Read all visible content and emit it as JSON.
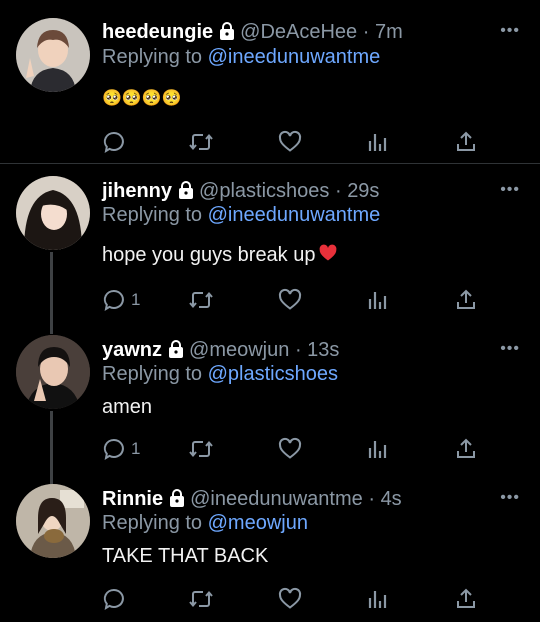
{
  "tweets": [
    {
      "name": "heedeungie",
      "handle": "@DeAceHee",
      "time": "7m",
      "replying_prefix": "Replying to",
      "replying_to": "@ineedunuwantme",
      "text": "🥺🥺🥺🥺",
      "reply_count": "",
      "locked": true
    },
    {
      "name": "jihenny",
      "handle": "@plasticshoes",
      "time": "29s",
      "replying_prefix": "Replying to",
      "replying_to": "@ineedunuwantme",
      "text": "hope you guys break up",
      "reply_count": "1",
      "locked": true
    },
    {
      "name": "yawnz",
      "handle": "@meowjun",
      "time": "13s",
      "replying_prefix": "Replying to",
      "replying_to": "@plasticshoes",
      "text": "amen",
      "reply_count": "1",
      "locked": true
    },
    {
      "name": "Rinnie",
      "handle": "@ineedunuwantme",
      "time": "4s",
      "replying_prefix": "Replying to",
      "replying_to": "@meowjun",
      "text": "TAKE THAT BACK",
      "reply_count": "",
      "locked": true
    }
  ],
  "separator": "·",
  "icons": {
    "reply": "reply-icon",
    "retweet": "retweet-icon",
    "like": "heart-icon",
    "analytics": "analytics-icon",
    "share": "share-icon",
    "more": "more-icon",
    "lock": "lock-icon",
    "heart_emoji": "red-heart-emoji",
    "pleading_emoji": "pleading-face-emoji"
  },
  "colors": {
    "background": "#000000",
    "mention": "#6ea8ff",
    "secondary_text": "#8b98a5"
  }
}
